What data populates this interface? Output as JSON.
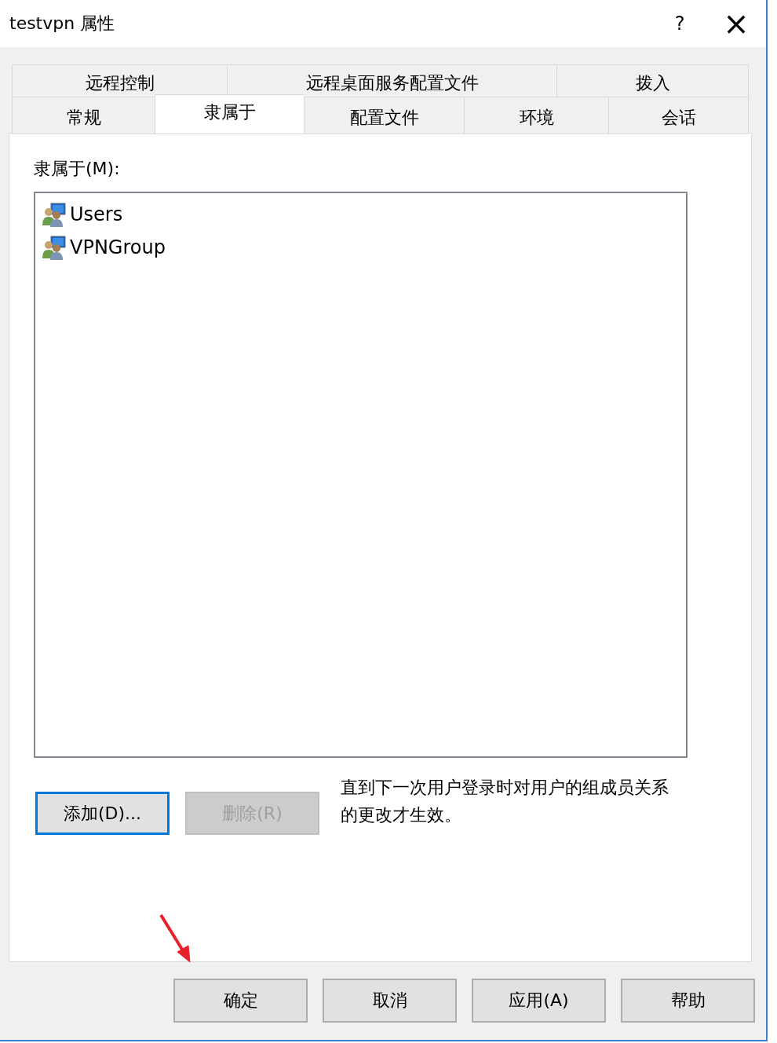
{
  "window": {
    "title": "testvpn 属性",
    "help": "?",
    "close": "×"
  },
  "tab_rows": [
    {
      "tabs": [
        {
          "label": "远程控制",
          "selected": false
        },
        {
          "label": "远程桌面服务配置文件",
          "selected": false
        },
        {
          "label": "拨入",
          "selected": false
        }
      ]
    },
    {
      "tabs": [
        {
          "label": "常规",
          "selected": false
        },
        {
          "label": "隶属于",
          "selected": true
        },
        {
          "label": "配置文件",
          "selected": false
        },
        {
          "label": "环境",
          "selected": false
        },
        {
          "label": "会话",
          "selected": false
        }
      ]
    }
  ],
  "member_of": {
    "label": "隶属于(M):",
    "items": [
      {
        "name": "Users",
        "selected": false
      },
      {
        "name": "VPNGroup",
        "selected": false
      }
    ]
  },
  "list_buttons": [
    {
      "label": "添加(D)...",
      "disabled": false,
      "focused": true
    },
    {
      "label": "删除(R)",
      "disabled": true,
      "focused": false
    }
  ],
  "note": "直到下一次用户登录时对用户的组成员关系的更改才生效。",
  "footer_buttons": [
    {
      "label": "确定"
    },
    {
      "label": "取消"
    },
    {
      "label": "应用(A)"
    },
    {
      "label": "帮助"
    }
  ]
}
